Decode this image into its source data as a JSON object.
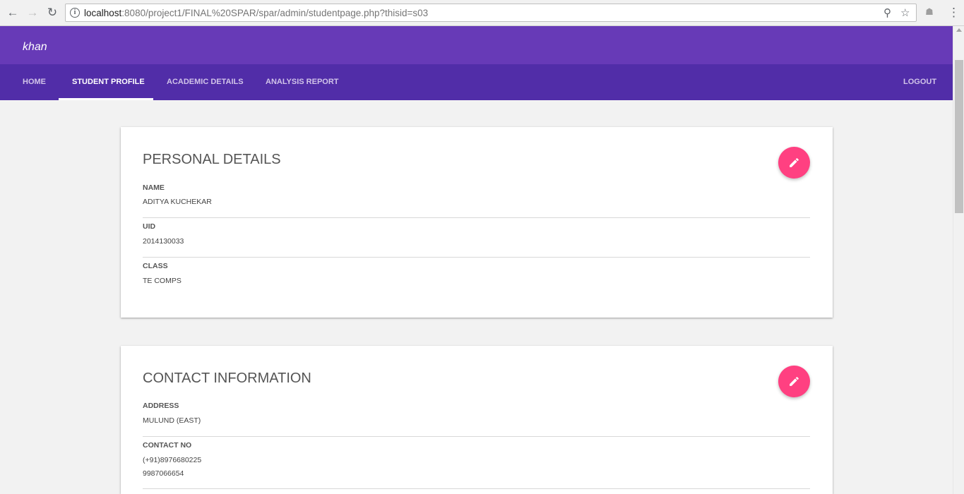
{
  "browser": {
    "url_host": "localhost",
    "url_rest": ":8080/project1/FINAL%20SPAR/spar/admin/studentpage.php?thisid=s03"
  },
  "app": {
    "brand": "khan"
  },
  "nav": {
    "tabs": [
      {
        "label": "HOME",
        "active": false
      },
      {
        "label": "STUDENT PROFILE",
        "active": true
      },
      {
        "label": "ACADEMIC DETAILS",
        "active": false
      },
      {
        "label": "ANALYSIS REPORT",
        "active": false
      }
    ],
    "logout": "LOGOUT"
  },
  "personal": {
    "title": "PERSONAL DETAILS",
    "fields": [
      {
        "label": "NAME",
        "value": "ADITYA KUCHEKAR"
      },
      {
        "label": "UID",
        "value": "2014130033"
      },
      {
        "label": "CLASS",
        "value": "TE COMPS"
      }
    ]
  },
  "contact": {
    "title": "CONTACT INFORMATION",
    "fields": [
      {
        "label": "ADDRESS",
        "value": "MULUND (EAST)"
      },
      {
        "label": "CONTACT NO",
        "value": "(+91)8976680225",
        "value2": "9987066654"
      }
    ]
  },
  "colors": {
    "appbar": "#673ab7",
    "tabbar": "#512da8",
    "fab": "#ff4081"
  }
}
